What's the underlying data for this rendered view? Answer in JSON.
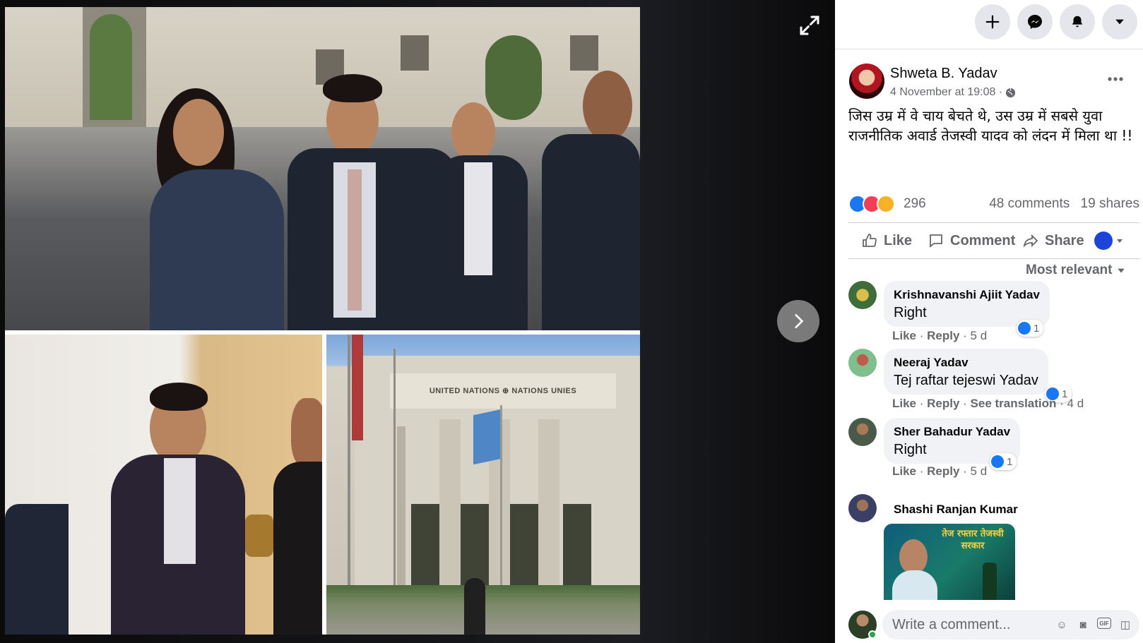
{
  "post": {
    "author": "Shweta B. Yadav",
    "time": "4 November at 19:08 ·",
    "text": "जिस उम्र में वे चाय बेचते थे, उस उम्र में सबसे युवा राजनीतिक अवार्ड तेजस्वी यादव को लंदन में मिला था !!",
    "reaction_count": "296",
    "comments_count": "48 comments",
    "shares_count": "19 shares"
  },
  "actions": {
    "like": "Like",
    "comment": "Comment",
    "share": "Share"
  },
  "sort_label": "Most relevant",
  "photo": {
    "building_sign": "UNITED NATIONS ⊕ NATIONS UNIES"
  },
  "comments": [
    {
      "name": "Krishnavanshi Ajiit Yadav",
      "text": "Right",
      "like": "Like",
      "reply": "Reply",
      "age": "5 d",
      "likes": "1"
    },
    {
      "name": "Neeraj Yadav",
      "text": "Tej raftar tejeswi Yadav",
      "like": "Like",
      "reply": "Reply",
      "translate": "See translation",
      "age": "4 d",
      "likes": "1"
    },
    {
      "name": "Sher Bahadur Yadav",
      "text": "Right",
      "like": "Like",
      "reply": "Reply",
      "age": "5 d",
      "likes": "1"
    },
    {
      "name": "Shashi Ranjan Kumar",
      "image_text": "तेज रफ्तार तेजस्वी सरकार"
    }
  ],
  "write_placeholder": "Write a comment...",
  "colors": {
    "accent": "#1877f2",
    "love": "#f33e58",
    "haha": "#f7b125",
    "online": "#31a24c"
  }
}
